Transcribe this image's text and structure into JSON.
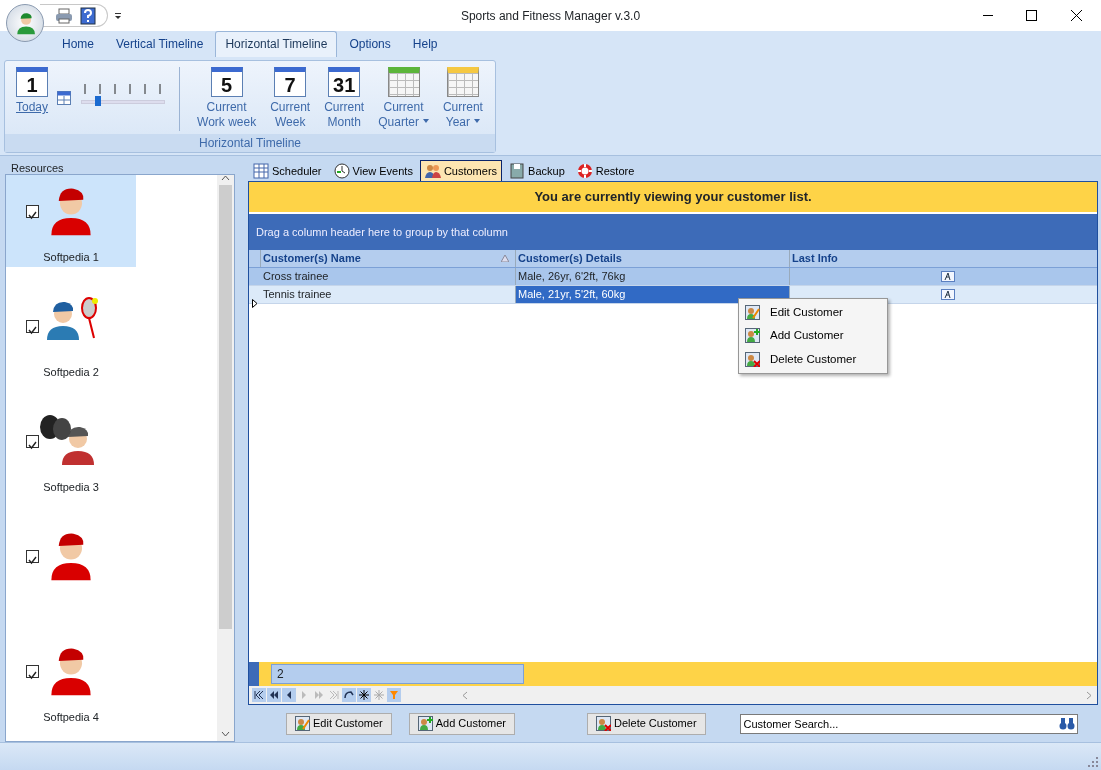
{
  "window": {
    "title": "Sports and Fitness Manager v.3.0"
  },
  "ribbon_tabs": [
    {
      "label": "Home",
      "selected": false
    },
    {
      "label": "Vertical Timeline",
      "selected": false
    },
    {
      "label": "Horizontal Timeline",
      "selected": true
    },
    {
      "label": "Options",
      "selected": false
    },
    {
      "label": "Help",
      "selected": false
    }
  ],
  "ribbon": {
    "group_label": "Horizontal Timeline",
    "today": {
      "icon_text": "1",
      "label": "Today"
    },
    "zoom_slider": {
      "level": 0.2
    },
    "buttons": [
      {
        "icon_text": "5",
        "kind": "calendar",
        "lines": [
          "Current",
          "Work week"
        ],
        "dropdown": false
      },
      {
        "icon_text": "7",
        "kind": "calendar",
        "lines": [
          "Current",
          "Week"
        ],
        "dropdown": false
      },
      {
        "icon_text": "31",
        "kind": "calendar",
        "lines": [
          "Current",
          "Month"
        ],
        "dropdown": false
      },
      {
        "kind": "grid-green",
        "lines": [
          "Current",
          "Quarter"
        ],
        "dropdown": true
      },
      {
        "kind": "grid-yellow",
        "lines": [
          "Current",
          "Year"
        ],
        "dropdown": true
      }
    ]
  },
  "resources": {
    "title": "Resources",
    "items": [
      {
        "name": "Softpedia 1",
        "kind": "cap",
        "checked": true,
        "selected": true
      },
      {
        "name": "Softpedia 2",
        "kind": "tennis",
        "checked": true,
        "selected": false
      },
      {
        "name": "Softpedia 3",
        "kind": "boxing",
        "checked": true,
        "selected": false
      },
      {
        "kind": "cap",
        "checked": true,
        "selected": false
      },
      {
        "name": "Softpedia 4",
        "kind": "cap",
        "checked": true,
        "selected": false
      }
    ]
  },
  "view_tabs": [
    {
      "label": "Scheduler",
      "selected": false
    },
    {
      "label": "View Events",
      "selected": false
    },
    {
      "label": "Customers",
      "selected": true
    },
    {
      "label": "Backup",
      "selected": false
    },
    {
      "label": "Restore",
      "selected": false
    }
  ],
  "banner": "You are currently viewing your customer list.",
  "group_hint": "Drag a column header here to group by that column",
  "table": {
    "columns": [
      "Customer(s) Name",
      "Customer(s) Details",
      "Last Info"
    ],
    "rows": [
      {
        "cells": [
          "Cross trainee",
          "Male, 26yr, 6'2ft, 76kg"
        ],
        "selected": false
      },
      {
        "cells": [
          "Tennis trainee",
          "Male, 21yr, 5'2ft, 60kg"
        ],
        "selected": true
      }
    ],
    "footer_count": "2"
  },
  "context_menu": [
    "Edit Customer",
    "Add Customer",
    "Delete Customer"
  ],
  "actions": [
    "Edit Customer",
    "Add Customer",
    "Delete Customer"
  ],
  "search": {
    "value": "Customer Search..."
  }
}
